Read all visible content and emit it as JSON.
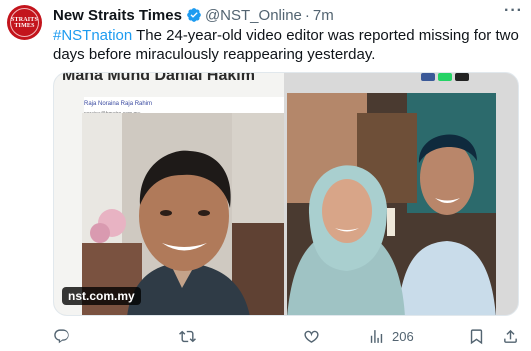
{
  "tweet": {
    "author_name": "New Straits Times",
    "handle": "@NST_Online",
    "separator": "·",
    "time": "7m",
    "hashtag": "#NSTnation",
    "body": " The 24-year-old video editor was reported missing for two days before miraculously reappearing yesterday.",
    "more_label": "···"
  },
  "avatar": {
    "line1": "STRAITS",
    "line2": "TIMES",
    "bg": "#c3141c"
  },
  "media": {
    "article_title": "Mana Muhd Danial Hakim",
    "byline": "Raja Noraina Raja Rahim",
    "email": "noraina@hmetro.com.my",
    "watermark": "nst.com.my"
  },
  "actions": {
    "views": "206"
  },
  "colors": {
    "accent": "#1d9bf0",
    "muted": "#536471"
  }
}
